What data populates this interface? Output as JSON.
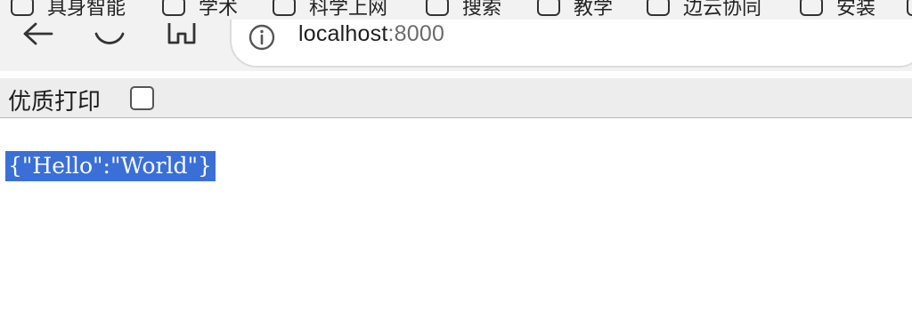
{
  "bookmarks": [
    {
      "label": "具身智能",
      "icon": "folder-icon"
    },
    {
      "label": "学术",
      "icon": "folder-icon"
    },
    {
      "label": "科学上网",
      "icon": "folder-icon"
    },
    {
      "label": "搜索",
      "icon": "folder-icon"
    },
    {
      "label": "教学",
      "icon": "folder-icon"
    },
    {
      "label": "边云协同",
      "icon": "folder-icon"
    },
    {
      "label": "安装",
      "icon": "folder-icon"
    }
  ],
  "navbar": {
    "back_icon": "back-arrow-icon",
    "reload_icon": "reload-icon",
    "home_icon": "home-icon",
    "address": {
      "info_icon": "info-icon",
      "host": "localhost",
      "port": ":8000"
    }
  },
  "printbar": {
    "label": "优质打印",
    "checked": false
  },
  "page": {
    "body_text": "{\"Hello\":\"World\"}"
  }
}
